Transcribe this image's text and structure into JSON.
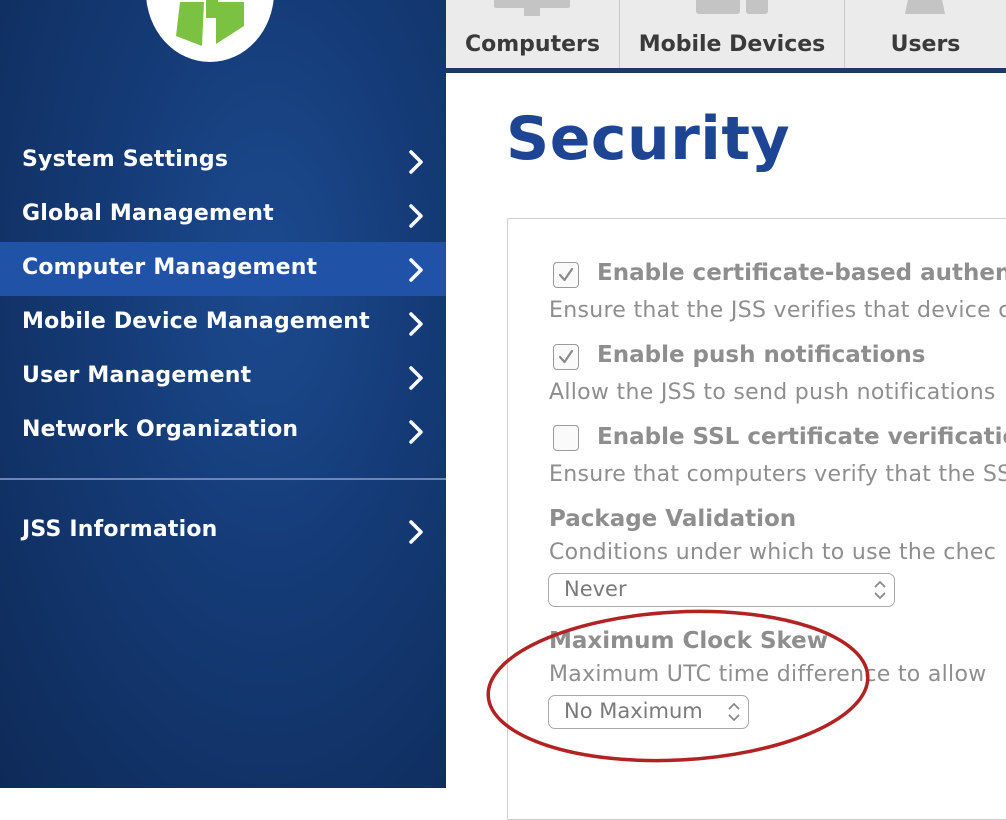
{
  "sidebar": {
    "items": [
      {
        "label": "System Settings"
      },
      {
        "label": "Global Management"
      },
      {
        "label": "Computer Management"
      },
      {
        "label": "Mobile Device Management"
      },
      {
        "label": "User Management"
      },
      {
        "label": "Network Organization"
      },
      {
        "label": "JSS Information"
      }
    ],
    "active_item": "Computer Management"
  },
  "tabs": [
    {
      "label": "Computers",
      "icon": "monitor-icon"
    },
    {
      "label": "Mobile Devices",
      "icon": "devices-icon"
    },
    {
      "label": "Users",
      "icon": "user-icon"
    }
  ],
  "page": {
    "title": "Security"
  },
  "settings": {
    "cert_auth": {
      "title": "Enable certificate-based authenti",
      "description": "Ensure that the JSS verifies that device c",
      "checked": true
    },
    "push_notifications": {
      "title": "Enable push notifications",
      "description": "Allow the JSS to send push notifications",
      "checked": true
    },
    "ssl_verification": {
      "title": "Enable SSL certificate verification",
      "description": "Ensure that computers verify that the SS",
      "checked": false
    },
    "package_validation": {
      "title": "Package Validation",
      "description": "Conditions under which to use the chec",
      "selected": "Never"
    },
    "clock_skew": {
      "title": "Maximum Clock Skew",
      "description": "Maximum UTC time difference to allow",
      "selected": "No Maximum"
    }
  },
  "colors": {
    "sidebar_bg": "#143a75",
    "active_item": "#2052a8",
    "title": "#1e4594",
    "annotation": "#b22222",
    "logo_green": "#7cc242"
  }
}
